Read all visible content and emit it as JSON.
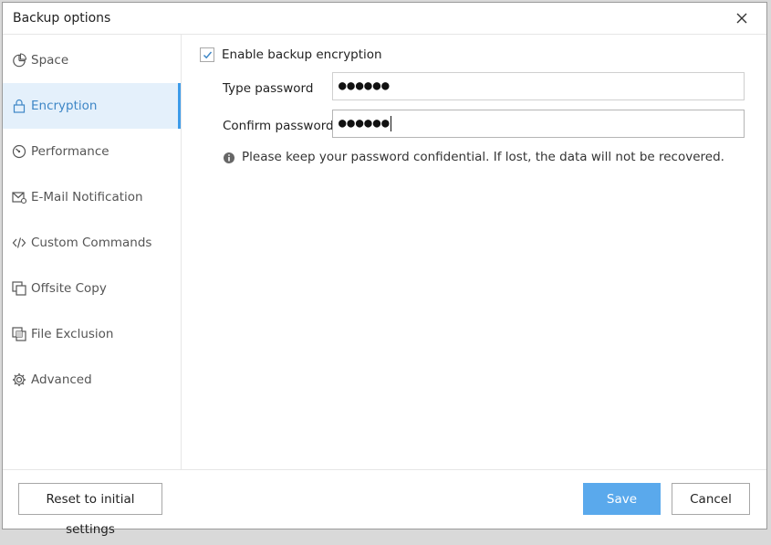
{
  "window": {
    "title": "Backup options"
  },
  "sidebar": {
    "items": [
      {
        "label": "Space",
        "icon": "pie-chart-icon"
      },
      {
        "label": "Encryption",
        "icon": "lock-icon",
        "active": true
      },
      {
        "label": "Performance",
        "icon": "gauge-icon"
      },
      {
        "label": "E-Mail Notification",
        "icon": "mail-gear-icon"
      },
      {
        "label": "Custom Commands",
        "icon": "code-icon"
      },
      {
        "label": "Offsite Copy",
        "icon": "copy-icon"
      },
      {
        "label": "File Exclusion",
        "icon": "exclude-icon"
      },
      {
        "label": "Advanced",
        "icon": "gear-icon"
      }
    ]
  },
  "encryption": {
    "enable_label": "Enable backup encryption",
    "enabled": true,
    "type_password_label": "Type password",
    "type_password_value": "●●●●●●",
    "confirm_password_label": "Confirm password",
    "confirm_password_value": "●●●●●●",
    "info_text": "Please keep your password confidential.  If lost, the data will not be recovered."
  },
  "footer": {
    "reset_label": "Reset to initial settings",
    "save_label": "Save",
    "cancel_label": "Cancel"
  },
  "colors": {
    "accent": "#3d9be9",
    "active_bg": "#e4f0fb",
    "save_button": "#5aa9ec"
  }
}
